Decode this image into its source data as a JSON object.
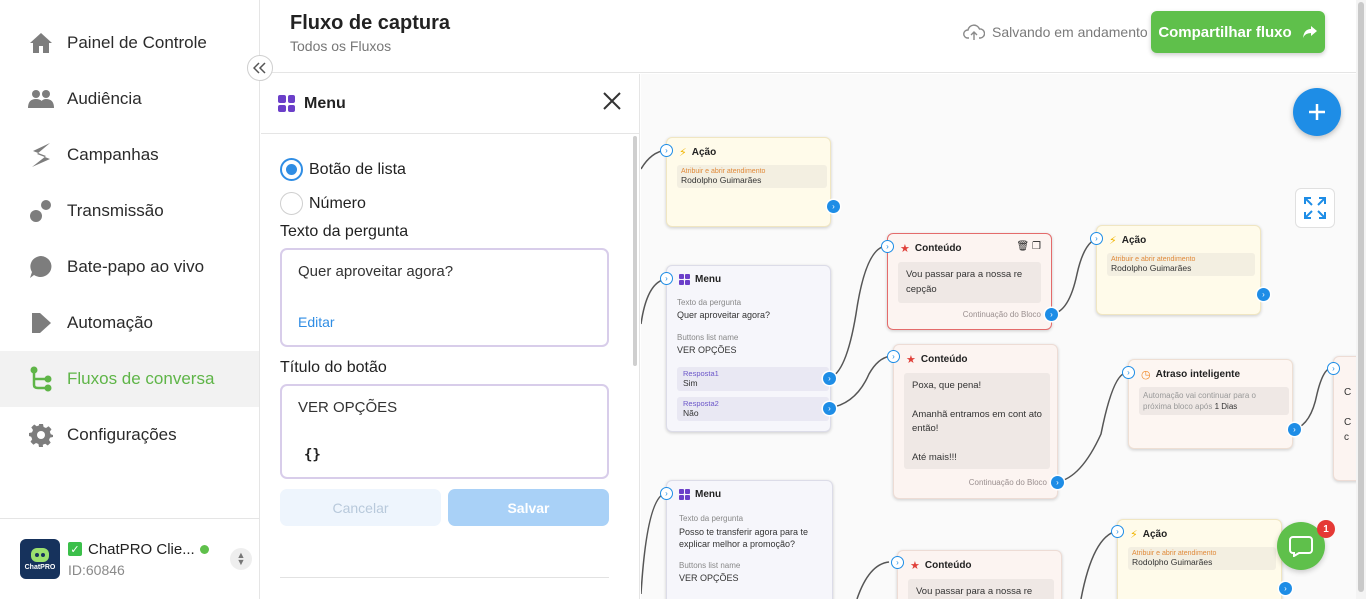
{
  "sidebar": {
    "items": [
      {
        "label": "Painel de Controle",
        "icon": "home-icon"
      },
      {
        "label": "Audiência",
        "icon": "people-icon"
      },
      {
        "label": "Campanhas",
        "icon": "campaign-icon"
      },
      {
        "label": "Transmissão",
        "icon": "broadcast-icon"
      },
      {
        "label": "Bate-papo ao vivo",
        "icon": "chat-icon"
      },
      {
        "label": "Automação",
        "icon": "automation-icon"
      },
      {
        "label": "Fluxos de conversa",
        "icon": "flow-icon",
        "active": true
      },
      {
        "label": "Configurações",
        "icon": "gear-icon"
      }
    ],
    "account": {
      "name": "ChatPRO Clie...",
      "id": "ID:60846",
      "logo_text": "ChatPRO"
    },
    "accent": "#5fb548"
  },
  "header": {
    "title": "Fluxo de captura",
    "subtitle": "Todos os Fluxos",
    "saving": "Salvando em andamento",
    "share": "Compartilhar fluxo"
  },
  "panel": {
    "title": "Menu",
    "radio_list": "Botão de lista",
    "radio_number": "Número",
    "question_label": "Texto da pergunta",
    "question_value": "Quer aproveitar agora?",
    "edit": "Editar",
    "button_title_label": "Título do botão",
    "button_title_value": "VER OPÇÕES",
    "braces": "{}",
    "cancel": "Cancelar",
    "save": "Salvar"
  },
  "canvas": {
    "action1": {
      "title": "Ação",
      "key": "Atribuir e abrir atendimento",
      "value": "Rodolpho Guimarães"
    },
    "menu1": {
      "title": "Menu",
      "q_label": "Texto da pergunta",
      "q_value": "Quer aproveitar agora?",
      "b_label": "Buttons list name",
      "b_value": "VER OPÇÕES",
      "r1_key": "Resposta1",
      "r1_val": "Sim",
      "r2_key": "Resposta2",
      "r2_val": "Não"
    },
    "content1": {
      "title": "Conteúdo",
      "text": "Vou passar para a nossa re cepção",
      "footer": "Continuação do Bloco"
    },
    "action2": {
      "title": "Ação",
      "key": "Atribuir e abrir atendimento",
      "value": "Rodolpho Guimarães"
    },
    "content2": {
      "title": "Conteúdo",
      "line1": "Poxa, que pena!",
      "line2": "Amanhã entramos em cont ato então!",
      "line3": "Até mais!!!",
      "footer": "Continuação do Bloco"
    },
    "delay": {
      "title": "Atraso inteligente",
      "text": "Automação vai continuar para o próxima bloco após",
      "value": "1 Dias"
    },
    "menu2": {
      "title": "Menu",
      "q_label": "Texto da pergunta",
      "q_value": "Posso te transferir agora para te explicar melhor a promoção?",
      "b_label": "Buttons list name",
      "b_value": "VER OPÇÕES"
    },
    "content3": {
      "title": "Conteúdo",
      "text": "Vou passar para a nossa re"
    },
    "action3": {
      "title": "Ação",
      "key": "Atribuir e abrir atendimento",
      "value": "Rodolpho Guimarães"
    },
    "partial": {
      "c1": "C",
      "c2": "C",
      "c3": "c"
    },
    "chat_badge": "1"
  }
}
